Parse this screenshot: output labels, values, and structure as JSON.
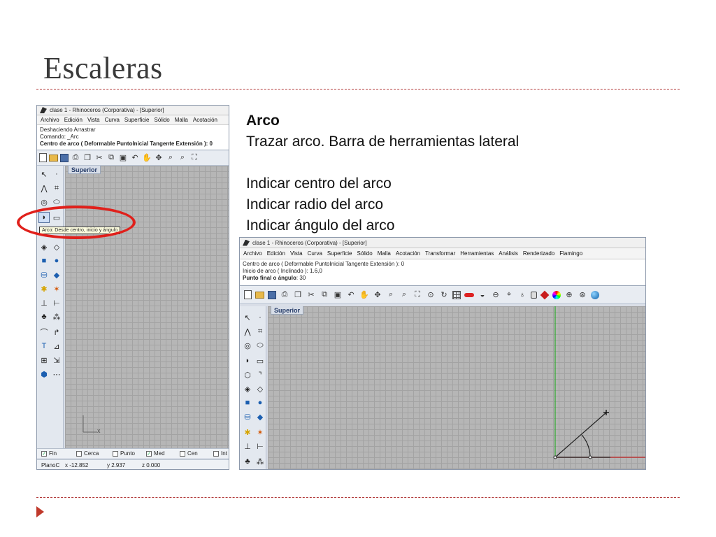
{
  "slide": {
    "title": "Escaleras",
    "text": {
      "heading": "Arco",
      "subtitle": "Trazar arco. Barra de herramientas lateral",
      "steps": [
        "Indicar centro del arco",
        "Indicar radio del arco",
        "Indicar ángulo del arco"
      ]
    }
  },
  "colors": {
    "accent_rule": "#b23a3a",
    "ellipse": "#e0201b",
    "viewport_bg": "#b6b6b6"
  },
  "left_window": {
    "title": "clase 1 - Rhinoceros (Corporativa) - [Superior]",
    "menu": [
      "Archivo",
      "Edición",
      "Vista",
      "Curva",
      "Superficie",
      "Sólido",
      "Malla",
      "Acotación"
    ],
    "cmd_lines": [
      "Deshaciendo Arrastrar",
      "Comando: _Arc"
    ],
    "cmd_prompt": "Centro de arco ( Deformable  PuntoInicial  Tangente  Extensión ): 0",
    "viewport_label": "Superior",
    "tooltip": "Arco: Desde centro, inicio y ángulo",
    "axis_x": "x",
    "osnaps": [
      {
        "label": "Fin",
        "checked": true
      },
      {
        "label": "Cerca",
        "checked": false
      },
      {
        "label": "Punto",
        "checked": false
      },
      {
        "label": "Med",
        "checked": true
      },
      {
        "label": "Cen",
        "checked": false
      },
      {
        "label": "Int",
        "checked": false
      }
    ],
    "status": {
      "plane": "PlanoC",
      "x": "x -12.852",
      "y": "y 2.937",
      "z": "z 0.000"
    }
  },
  "right_window": {
    "title": "clase 1 - Rhinoceros (Corporativa) - [Superior]",
    "menu": [
      "Archivo",
      "Edición",
      "Vista",
      "Curva",
      "Superficie",
      "Sólido",
      "Malla",
      "Acotación",
      "Transformar",
      "Herramientas",
      "Análisis",
      "Renderizado",
      "Flamingo"
    ],
    "cmd_lines": [
      "Centro de arco ( Deformable  PuntoInicial  Tangente  Extensión ): 0",
      "Inicio de arco ( Inclinado ): 1.6,0"
    ],
    "cmd_prompt_label": "Punto final o ángulo",
    "cmd_prompt_value": ": 30",
    "viewport_label": "Superior"
  }
}
